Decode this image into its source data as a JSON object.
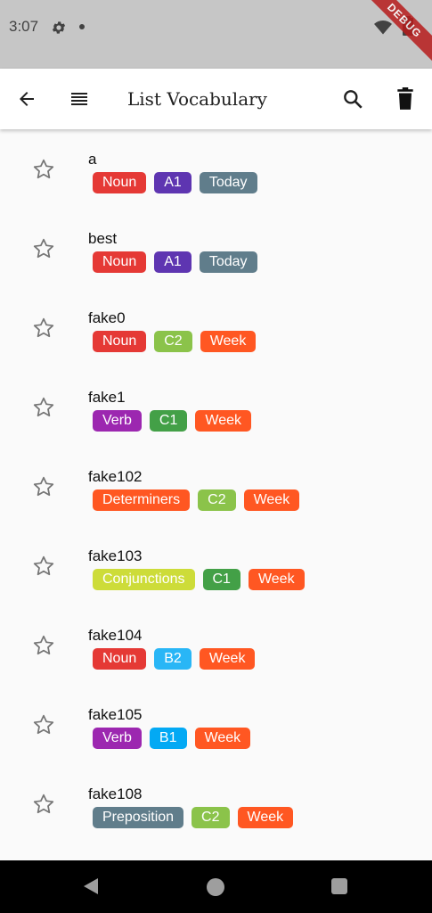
{
  "status_bar": {
    "time": "3:07",
    "debug_label": "DEBUG"
  },
  "app_bar": {
    "title": "List Vocabulary",
    "icons": [
      "arrow-back-icon",
      "menu-icon",
      "search-icon",
      "delete-icon"
    ]
  },
  "vocabulary": [
    {
      "word": "a",
      "tags": [
        {
          "label": "Noun",
          "color": "#e53935"
        },
        {
          "label": "A1",
          "color": "#5e35b1"
        },
        {
          "label": "Today",
          "color": "#607d8b"
        }
      ]
    },
    {
      "word": "best",
      "tags": [
        {
          "label": "Noun",
          "color": "#e53935"
        },
        {
          "label": "A1",
          "color": "#5e35b1"
        },
        {
          "label": "Today",
          "color": "#607d8b"
        }
      ]
    },
    {
      "word": "fake0",
      "tags": [
        {
          "label": "Noun",
          "color": "#e53935"
        },
        {
          "label": "C2",
          "color": "#8bc34a"
        },
        {
          "label": "Week",
          "color": "#ff5722"
        }
      ]
    },
    {
      "word": "fake1",
      "tags": [
        {
          "label": "Verb",
          "color": "#9c27b0"
        },
        {
          "label": "C1",
          "color": "#43a047"
        },
        {
          "label": "Week",
          "color": "#ff5722"
        }
      ]
    },
    {
      "word": "fake102",
      "tags": [
        {
          "label": "Determiners",
          "color": "#ff5722"
        },
        {
          "label": "C2",
          "color": "#8bc34a"
        },
        {
          "label": "Week",
          "color": "#ff5722"
        }
      ]
    },
    {
      "word": "fake103",
      "tags": [
        {
          "label": "Conjunctions",
          "color": "#cddc39"
        },
        {
          "label": "C1",
          "color": "#43a047"
        },
        {
          "label": "Week",
          "color": "#ff5722"
        }
      ]
    },
    {
      "word": "fake104",
      "tags": [
        {
          "label": "Noun",
          "color": "#e53935"
        },
        {
          "label": "B2",
          "color": "#29b6f6"
        },
        {
          "label": "Week",
          "color": "#ff5722"
        }
      ]
    },
    {
      "word": "fake105",
      "tags": [
        {
          "label": "Verb",
          "color": "#9c27b0"
        },
        {
          "label": "B1",
          "color": "#03a9f4"
        },
        {
          "label": "Week",
          "color": "#ff5722"
        }
      ]
    },
    {
      "word": "fake108",
      "tags": [
        {
          "label": "Preposition",
          "color": "#607d8b"
        },
        {
          "label": "C2",
          "color": "#8bc34a"
        },
        {
          "label": "Week",
          "color": "#ff5722"
        }
      ]
    }
  ],
  "colors": {
    "app_bar_bg": "#ffffff",
    "status_bar_bg": "#c6c6c6",
    "background": "#fafafa",
    "star_outline": "#757575"
  }
}
